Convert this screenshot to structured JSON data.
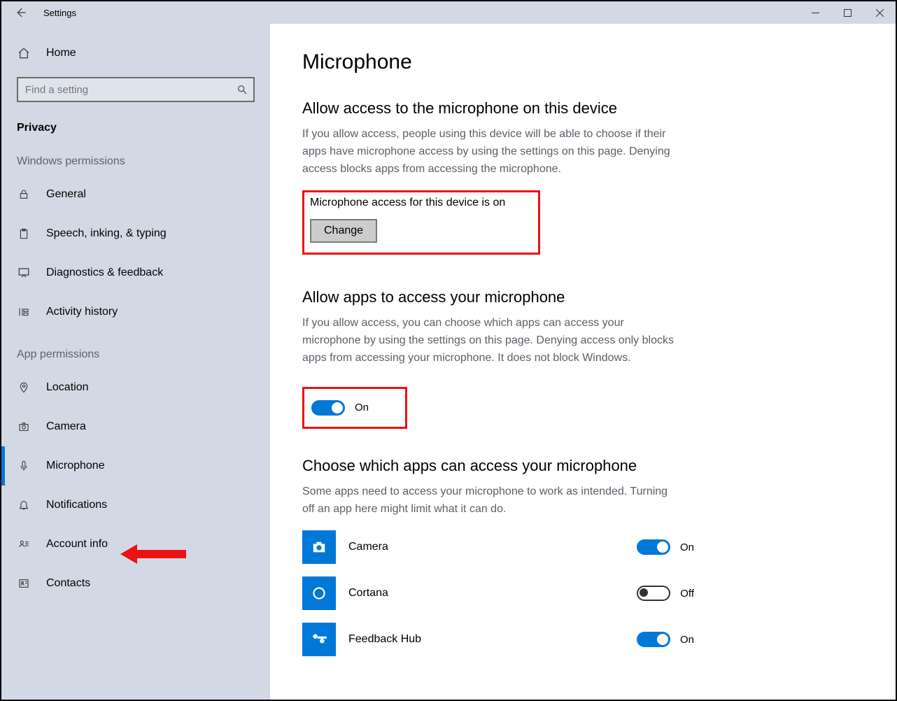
{
  "titlebar": {
    "title": "Settings"
  },
  "sidebar": {
    "home_label": "Home",
    "search_placeholder": "Find a setting",
    "category_label": "Privacy",
    "section_windows": "Windows permissions",
    "section_app": "App permissions",
    "win_items": [
      {
        "label": "General"
      },
      {
        "label": "Speech, inking, & typing"
      },
      {
        "label": "Diagnostics & feedback"
      },
      {
        "label": "Activity history"
      }
    ],
    "app_items": [
      {
        "label": "Location"
      },
      {
        "label": "Camera"
      },
      {
        "label": "Microphone",
        "active": true
      },
      {
        "label": "Notifications"
      },
      {
        "label": "Account info"
      },
      {
        "label": "Contacts"
      }
    ]
  },
  "main": {
    "title": "Microphone",
    "section1": {
      "heading": "Allow access to the microphone on this device",
      "desc": "If you allow access, people using this device will be able to choose if their apps have microphone access by using the settings on this page. Denying access blocks apps from accessing the microphone.",
      "status": "Microphone access for this device is on",
      "button": "Change"
    },
    "section2": {
      "heading": "Allow apps to access your microphone",
      "desc": "If you allow access, you can choose which apps can access your microphone by using the settings on this page. Denying access only blocks apps from accessing your microphone. It does not block Windows.",
      "toggle_label": "On"
    },
    "section3": {
      "heading": "Choose which apps can access your microphone",
      "desc": "Some apps need to access your microphone to work as intended. Turning off an app here might limit what it can do.",
      "apps": [
        {
          "name": "Camera",
          "state": "On",
          "on": true
        },
        {
          "name": "Cortana",
          "state": "Off",
          "on": false
        },
        {
          "name": "Feedback Hub",
          "state": "On",
          "on": true
        }
      ]
    }
  }
}
